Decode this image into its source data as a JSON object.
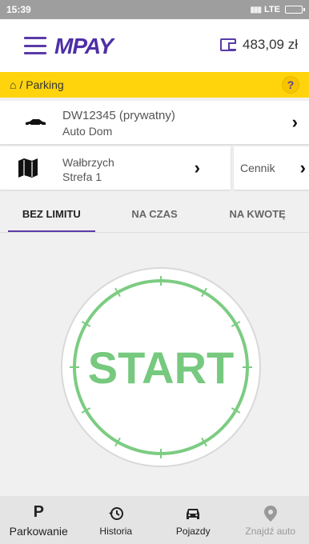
{
  "status_bar": {
    "time": "15:39",
    "network": "LTE"
  },
  "header": {
    "logo": "MPAY",
    "balance": "483,09 zł"
  },
  "breadcrumb": {
    "path": "/ Parking",
    "help": "?"
  },
  "vehicle": {
    "plate": "DW12345 (prywatny)",
    "name": "Auto Dom"
  },
  "zone": {
    "city": "Wałbrzych",
    "area": "Strefa 1"
  },
  "pricing": {
    "label": "Cennik"
  },
  "tabs": [
    {
      "label": "BEZ LIMITU",
      "active": true
    },
    {
      "label": "NA CZAS",
      "active": false
    },
    {
      "label": "NA KWOTĘ",
      "active": false
    }
  ],
  "start_button": {
    "label": "START"
  },
  "bottom_nav": [
    {
      "label": "Parkowanie",
      "icon": "parking-icon",
      "active": true
    },
    {
      "label": "Historia",
      "icon": "history-icon",
      "active": false
    },
    {
      "label": "Pojazdy",
      "icon": "car-icon",
      "active": false
    },
    {
      "label": "Znajdź auto",
      "icon": "location-pin-icon",
      "active": false
    }
  ],
  "colors": {
    "brand": "#5a3aa8",
    "accent": "#ffd40d",
    "start_green": "#76c97e"
  }
}
